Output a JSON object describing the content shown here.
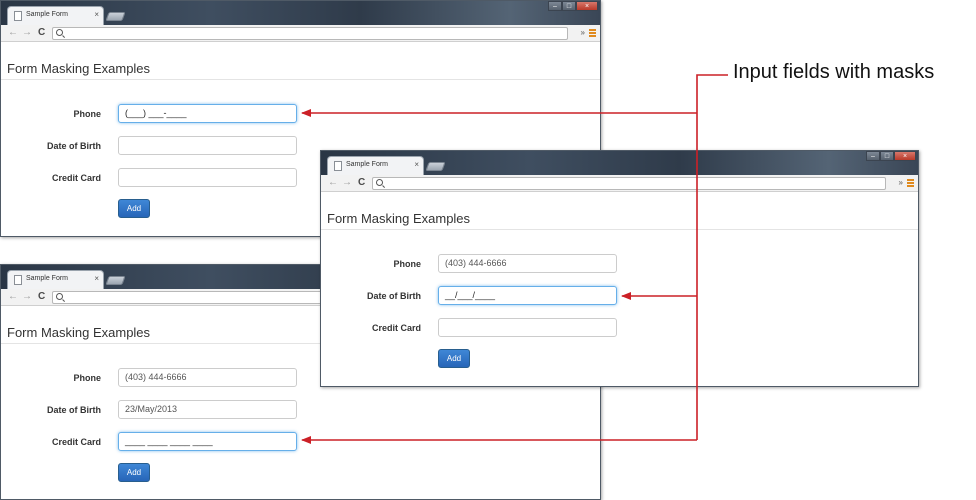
{
  "browser": {
    "tab_title": "Sample Form",
    "tab_close": "×",
    "win_min": "–",
    "win_max": "□",
    "win_close": "×",
    "back": "←",
    "forward": "→",
    "reload": "C",
    "chevron": "»"
  },
  "page": {
    "title": "Form Masking Examples",
    "labels": {
      "phone": "Phone",
      "dob": "Date of Birth",
      "card": "Credit Card"
    },
    "add_label": "Add"
  },
  "windows": [
    {
      "phone": "(___) ___-____",
      "dob": "",
      "card": "",
      "focused": "phone"
    },
    {
      "phone": "(403) 444-6666",
      "dob": "__/___/____",
      "card": "",
      "focused": "dob"
    },
    {
      "phone": "(403) 444-6666",
      "dob": "23/May/2013",
      "card": "____ ____ ____ ____",
      "focused": "card"
    }
  ],
  "annotation": {
    "text": "Input fields with masks",
    "color": "#cc2027"
  }
}
